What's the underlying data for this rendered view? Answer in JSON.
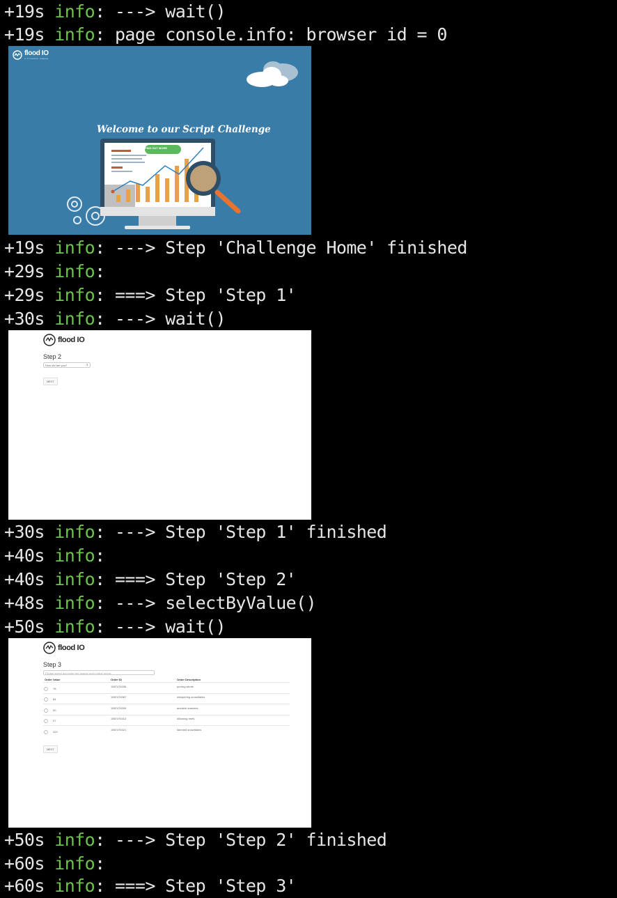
{
  "log": [
    {
      "time": "+19s",
      "level": "info",
      "msg": ": ---> wait()"
    },
    {
      "time": "+19s",
      "level": "info",
      "msg": ": page console.info: browser id = 0"
    },
    {
      "time": "+19s",
      "level": "info",
      "msg": ": ---> Step 'Challenge Home' finished"
    },
    {
      "time": "+29s",
      "level": "info",
      "msg": ":"
    },
    {
      "time": "+29s",
      "level": "info",
      "msg": ": ===> Step 'Step 1'"
    },
    {
      "time": "+30s",
      "level": "info",
      "msg": ": ---> wait()"
    },
    {
      "time": "+30s",
      "level": "info",
      "msg": ": ---> Step 'Step 1' finished"
    },
    {
      "time": "+40s",
      "level": "info",
      "msg": ":"
    },
    {
      "time": "+40s",
      "level": "info",
      "msg": ": ===> Step 'Step 2'"
    },
    {
      "time": "+48s",
      "level": "info",
      "msg": ": ---> selectByValue()"
    },
    {
      "time": "+50s",
      "level": "info",
      "msg": ": ---> wait()"
    },
    {
      "time": "+50s",
      "level": "info",
      "msg": ": ---> Step 'Step 2' finished"
    },
    {
      "time": "+60s",
      "level": "info",
      "msg": ":"
    },
    {
      "time": "+60s",
      "level": "info",
      "msg": ": ===> Step 'Step 3'"
    }
  ],
  "shot_home": {
    "logo": "flood IO",
    "logo_sub": "a Tricentis company",
    "title": "Welcome to our Script Challenge",
    "button": "FIND OUT MORE"
  },
  "shot_step2": {
    "logo": "flood IO",
    "heading": "Step 2",
    "select_value": "How old are you?",
    "next": "NEXT"
  },
  "shot_step3": {
    "logo": "flood IO",
    "heading": "Step 3",
    "input_placeholder": "Please select and enter the largest order value below",
    "columns": [
      "Order Value",
      "Order ID",
      "Order Description"
    ],
    "rows": [
      [
        "78",
        "1587476436",
        "purring winds"
      ],
      [
        "84",
        "1587476387",
        "whispering snowflakes"
      ],
      [
        "90",
        "1587476399",
        "amiable marshes"
      ],
      [
        "27",
        "1587476413",
        "billowing reefs"
      ],
      [
        "220",
        "1587476421",
        "talented snowflakes"
      ]
    ],
    "next": "NEXT"
  },
  "colors": {
    "info": "#6cc24a",
    "text": "#e6e6e6",
    "background": "#000000",
    "home_bg": "#3a7ca8",
    "button_green": "#5cb85c",
    "chart_orange": "#e9a04b"
  }
}
